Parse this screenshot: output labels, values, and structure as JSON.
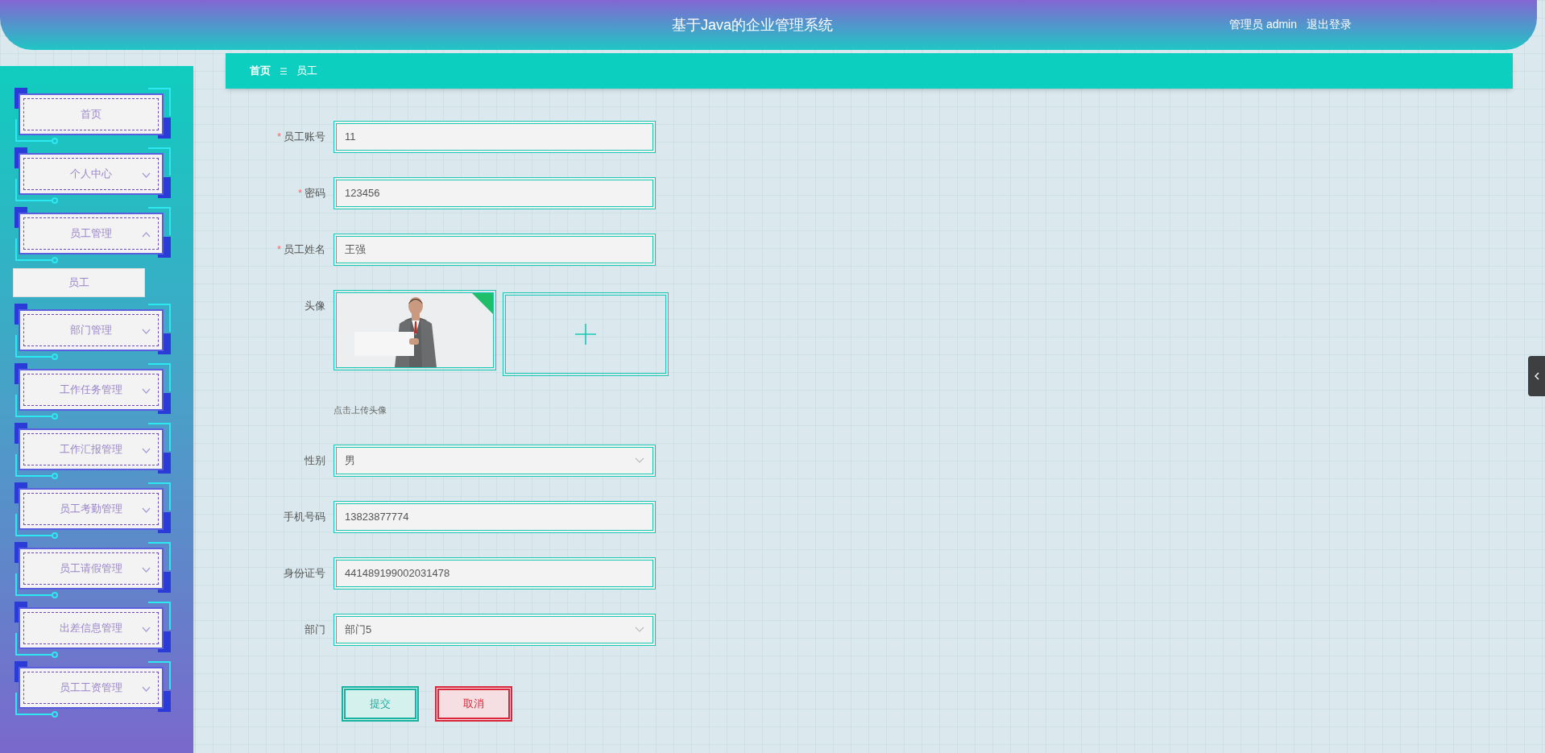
{
  "header": {
    "title": "基于Java的企业管理系统",
    "user": "管理员 admin",
    "logout": "退出登录"
  },
  "breadcrumb": [
    {
      "label": "首页",
      "current": false
    },
    {
      "label": "员工",
      "current": true
    }
  ],
  "sidebar": {
    "items": [
      {
        "label": "首页"
      },
      {
        "label": "个人中心",
        "expanded": false
      },
      {
        "label": "员工管理",
        "expanded": true,
        "children": [
          {
            "label": "员工",
            "selected": true
          }
        ]
      },
      {
        "label": "部门管理",
        "expanded": false
      },
      {
        "label": "工作任务管理",
        "expanded": false
      },
      {
        "label": "工作汇报管理",
        "expanded": false
      },
      {
        "label": "员工考勤管理",
        "expanded": false
      },
      {
        "label": "员工请假管理",
        "expanded": false
      },
      {
        "label": "出差信息管理",
        "expanded": false
      },
      {
        "label": "员工工资管理",
        "expanded": false
      }
    ]
  },
  "form": {
    "fields": [
      {
        "kind": "text",
        "label": "员工账号",
        "required_mark": "*",
        "value": "11"
      },
      {
        "kind": "text",
        "label": "密码",
        "required_mark": "*",
        "value": "123456"
      },
      {
        "kind": "text",
        "label": "员工姓名",
        "required_mark": "*",
        "value": "王强"
      },
      {
        "label": "头像",
        "hint": "点击上传头像"
      },
      {
        "kind": "select",
        "label": "性别",
        "value": "男"
      },
      {
        "kind": "text",
        "label": "手机号码",
        "value": "13823877774"
      },
      {
        "kind": "text",
        "label": "身份证号",
        "value": "441489199002031478"
      },
      {
        "kind": "select",
        "label": "部门",
        "value": "部门5"
      }
    ],
    "buttons": [
      {
        "kind": "submit",
        "label": "提交"
      },
      {
        "kind": "cancel",
        "label": "取消"
      }
    ]
  }
}
